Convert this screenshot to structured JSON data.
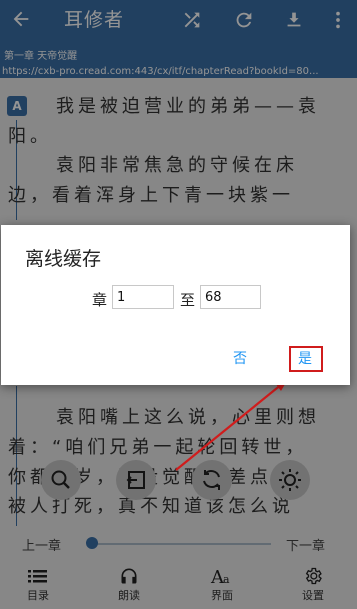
{
  "app_bar": {
    "title": "耳修者",
    "icons": [
      "back-arrow-icon",
      "shuffle-icon",
      "refresh-icon",
      "download-icon",
      "more-vertical-icon"
    ]
  },
  "chapter_url": {
    "chapter": "第一章 天帝觉醒",
    "url": "https://cxb-pro.cread.com:443/cx/itf/chapterRead?bookId=80..."
  },
  "reader": {
    "badge": "A",
    "lines": [
      "我是被迫营业的弟弟——袁",
      "阳。",
      "袁阳非常焦急的守候在床",
      "边，看着浑身上下青一块紫一",
      "袁阳嘴上这么说，心里则想",
      "着：“咱们兄弟一起轮回转世，",
      "你都六岁，还没觉醒，差点",
      "被人打死，真不知道该怎么说"
    ]
  },
  "dialog": {
    "title": "离线缓存",
    "from_label": "章",
    "from_value": "1",
    "to_label": "至",
    "to_value": "68",
    "cancel": "否",
    "confirm": "是"
  },
  "chapter_nav": {
    "prev": "上一章",
    "next": "下一章",
    "progress": 0.0
  },
  "tool_icons": [
    "search-icon",
    "exit-icon",
    "auto-flip-icon",
    "brightness-icon"
  ],
  "menu": [
    {
      "label": "目录",
      "icon": "list-icon"
    },
    {
      "label": "朗读",
      "icon": "headphones-icon"
    },
    {
      "label": "界面",
      "icon": "font-icon"
    },
    {
      "label": "设置",
      "icon": "gear-icon"
    }
  ],
  "colors": {
    "primary": "#3a6ea5",
    "accent": "#2196f3",
    "highlight": "#d01c1c"
  }
}
